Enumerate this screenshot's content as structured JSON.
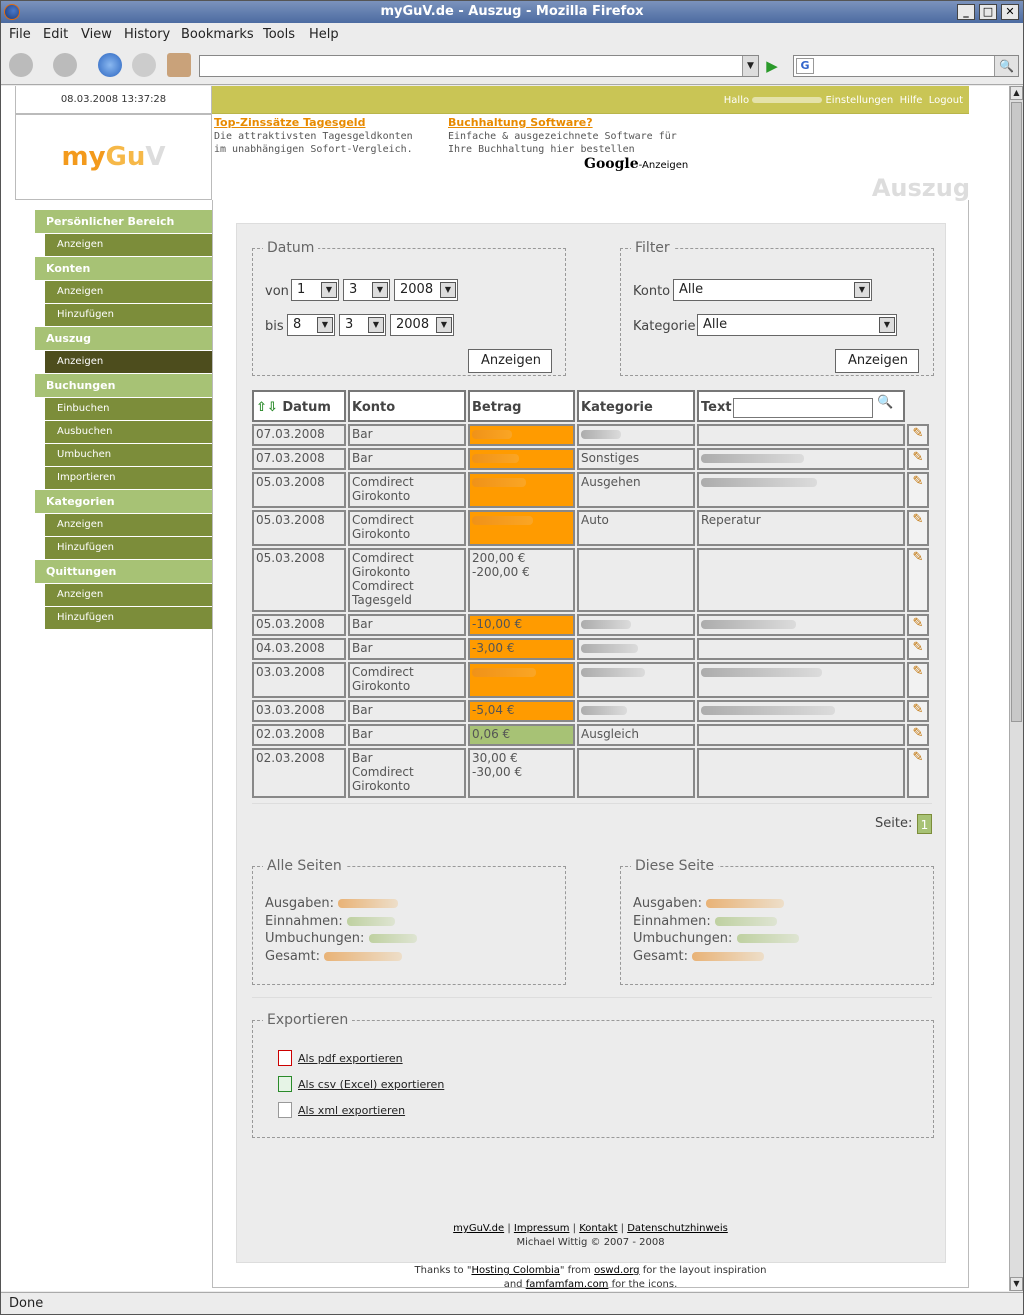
{
  "window": {
    "title": "myGuV.de - Auszug - Mozilla Firefox",
    "min": "_",
    "max": "□",
    "close": "✕"
  },
  "menu": [
    "File",
    "Edit",
    "View",
    "History",
    "Bookmarks",
    "Tools",
    "Help"
  ],
  "status": "Done",
  "header": {
    "datetime": "08.03.2008 13:37:28",
    "logo": {
      "my": "my",
      "gu": "Gu",
      "v": "V"
    },
    "hello_label": "Hallo",
    "links": [
      "Einstellungen",
      "Hilfe",
      "Logout"
    ],
    "title": "Auszug"
  },
  "ads": [
    {
      "title": "Top-Zinssätze Tagesgeld",
      "text": "Die attraktivsten Tagesgeldkonten im unabhängigen Sofort-Vergleich."
    },
    {
      "title": "Buchhaltung Software?",
      "text": "Einfache & ausgezeichnete Software für Ihre Buchhaltung hier bestellen"
    }
  ],
  "ads_label": {
    "google": "Google",
    "suffix": "-Anzeigen"
  },
  "sidebar": [
    {
      "head": "Persönlicher Bereich",
      "items": [
        "Anzeigen"
      ]
    },
    {
      "head": "Konten",
      "items": [
        "Anzeigen",
        "Hinzufügen"
      ]
    },
    {
      "head": "Auszug",
      "items": [
        "Anzeigen"
      ],
      "active": 0
    },
    {
      "head": "Buchungen",
      "items": [
        "Einbuchen",
        "Ausbuchen",
        "Umbuchen",
        "Importieren"
      ]
    },
    {
      "head": "Kategorien",
      "items": [
        "Anzeigen",
        "Hinzufügen"
      ]
    },
    {
      "head": "Quittungen",
      "items": [
        "Anzeigen",
        "Hinzufügen"
      ]
    }
  ],
  "datum": {
    "legend": "Datum",
    "von_label": "von",
    "von": {
      "d": "1",
      "m": "3",
      "y": "2008"
    },
    "bis_label": "bis",
    "bis": {
      "d": "8",
      "m": "3",
      "y": "2008"
    },
    "button": "Anzeigen"
  },
  "filter": {
    "legend": "Filter",
    "konto_label": "Konto",
    "konto": "Alle",
    "kategorie_label": "Kategorie",
    "kategorie": "Alle",
    "button": "Anzeigen"
  },
  "table": {
    "headers": [
      "Datum",
      "Konto",
      "Betrag",
      "Kategorie",
      "Text"
    ],
    "rows": [
      {
        "datum": "07.03.2008",
        "konto": "Bar",
        "betrag": "",
        "kategorie": "",
        "text": "",
        "style": "or"
      },
      {
        "datum": "07.03.2008",
        "konto": "Bar",
        "betrag": "",
        "kategorie": "Sonstiges",
        "text": "",
        "style": "or"
      },
      {
        "datum": "05.03.2008",
        "konto": "Comdirect\nGirokonto",
        "betrag": "",
        "kategorie": "Ausgehen",
        "text": "",
        "style": "or"
      },
      {
        "datum": "05.03.2008",
        "konto": "Comdirect\nGirokonto",
        "betrag": "",
        "kategorie": "Auto",
        "text": "Reperatur",
        "style": "or"
      },
      {
        "datum": "05.03.2008",
        "konto": "Comdirect\nGirokonto\nComdirect\nTagesgeld",
        "betrag": "200,00 €\n-200,00 €",
        "kategorie": "",
        "text": "",
        "style": ""
      },
      {
        "datum": "05.03.2008",
        "konto": "Bar",
        "betrag": "-10,00 €",
        "kategorie": "",
        "text": "",
        "style": "or"
      },
      {
        "datum": "04.03.2008",
        "konto": "Bar",
        "betrag": "-3,00 €",
        "kategorie": "",
        "text": "",
        "style": "or"
      },
      {
        "datum": "03.03.2008",
        "konto": "Comdirect\nGirokonto",
        "betrag": "",
        "kategorie": "",
        "text": "",
        "style": "or"
      },
      {
        "datum": "03.03.2008",
        "konto": "Bar",
        "betrag": "-5,04 €",
        "kategorie": "",
        "text": "",
        "style": "or"
      },
      {
        "datum": "02.03.2008",
        "konto": "Bar",
        "betrag": "0,06 €",
        "kategorie": "Ausgleich",
        "text": "",
        "style": "gr"
      },
      {
        "datum": "02.03.2008",
        "konto": "Bar\nComdirect\nGirokonto",
        "betrag": "30,00 €\n-30,00 €",
        "kategorie": "",
        "text": "",
        "style": ""
      }
    ]
  },
  "pagination": {
    "label": "Seite:",
    "current": "1"
  },
  "summary_all": {
    "legend": "Alle Seiten",
    "rows": [
      "Ausgaben:",
      "Einnahmen:",
      "Umbuchungen:",
      "Gesamt:"
    ]
  },
  "summary_page": {
    "legend": "Diese Seite",
    "rows": [
      "Ausgaben:",
      "Einnahmen:",
      "Umbuchungen:",
      "Gesamt:"
    ]
  },
  "export": {
    "legend": "Exportieren",
    "items": [
      "Als pdf exportieren",
      "Als csv (Excel) exportieren",
      "Als xml exportieren"
    ]
  },
  "footer": {
    "links": [
      "myGuV.de",
      "Impressum",
      "Kontakt",
      "Datenschutzhinweis"
    ],
    "copyright": "Michael Wittig © 2007 - 2008",
    "thanks_pre": "Thanks to \"",
    "thanks_link1": "Hosting Colombia",
    "thanks_mid": "\" from ",
    "thanks_link2": "oswd.org",
    "thanks_post": " for the layout inspiration",
    "and_pre": "and ",
    "and_link": "famfamfam.com",
    "and_post": " for the icons."
  }
}
